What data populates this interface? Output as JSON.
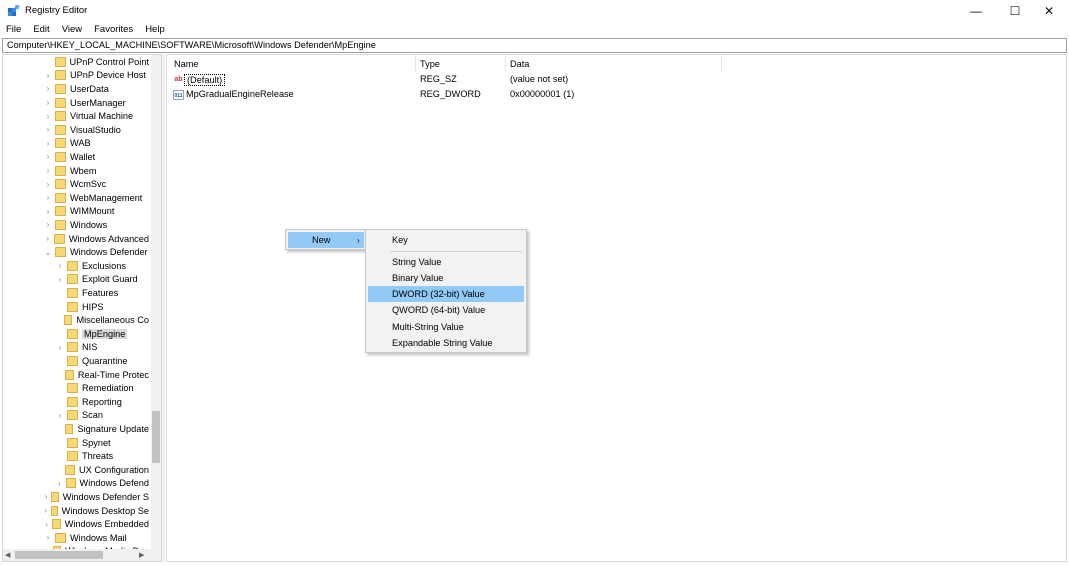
{
  "window": {
    "title": "Registry Editor",
    "min_glyph": "—",
    "max_glyph": "☐",
    "close_glyph": "✕"
  },
  "menu": [
    "File",
    "Edit",
    "View",
    "Favorites",
    "Help"
  ],
  "address": "Computer\\HKEY_LOCAL_MACHINE\\SOFTWARE\\Microsoft\\Windows Defender\\MpEngine",
  "tree": {
    "items": [
      {
        "label": "UPnP Control Point",
        "expander": "",
        "level": 0
      },
      {
        "label": "UPnP Device Host",
        "expander": ">",
        "level": 0
      },
      {
        "label": "UserData",
        "expander": ">",
        "level": 0
      },
      {
        "label": "UserManager",
        "expander": ">",
        "level": 0
      },
      {
        "label": "Virtual Machine",
        "expander": ">",
        "level": 0
      },
      {
        "label": "VisualStudio",
        "expander": ">",
        "level": 0
      },
      {
        "label": "WAB",
        "expander": ">",
        "level": 0
      },
      {
        "label": "Wallet",
        "expander": ">",
        "level": 0
      },
      {
        "label": "Wbem",
        "expander": ">",
        "level": 0
      },
      {
        "label": "WcmSvc",
        "expander": ">",
        "level": 0
      },
      {
        "label": "WebManagement",
        "expander": ">",
        "level": 0
      },
      {
        "label": "WIMMount",
        "expander": ">",
        "level": 0
      },
      {
        "label": "Windows",
        "expander": ">",
        "level": 0
      },
      {
        "label": "Windows Advanced",
        "expander": ">",
        "level": 0
      },
      {
        "label": "Windows Defender",
        "expander": "v",
        "level": 0
      },
      {
        "label": "Exclusions",
        "expander": ">",
        "level": 1
      },
      {
        "label": "Exploit Guard",
        "expander": ">",
        "level": 1
      },
      {
        "label": "Features",
        "expander": "",
        "level": 1
      },
      {
        "label": "HIPS",
        "expander": "",
        "level": 1
      },
      {
        "label": "Miscellaneous Co",
        "expander": "",
        "level": 1
      },
      {
        "label": "MpEngine",
        "expander": "",
        "level": 1,
        "selected": true
      },
      {
        "label": "NIS",
        "expander": ">",
        "level": 1
      },
      {
        "label": "Quarantine",
        "expander": "",
        "level": 1
      },
      {
        "label": "Real-Time Protec",
        "expander": "",
        "level": 1
      },
      {
        "label": "Remediation",
        "expander": "",
        "level": 1
      },
      {
        "label": "Reporting",
        "expander": "",
        "level": 1
      },
      {
        "label": "Scan",
        "expander": ">",
        "level": 1
      },
      {
        "label": "Signature Update",
        "expander": "",
        "level": 1
      },
      {
        "label": "Spynet",
        "expander": "",
        "level": 1
      },
      {
        "label": "Threats",
        "expander": "",
        "level": 1
      },
      {
        "label": "UX Configuration",
        "expander": "",
        "level": 1
      },
      {
        "label": "Windows Defend",
        "expander": ">",
        "level": 1
      },
      {
        "label": "Windows Defender S",
        "expander": ">",
        "level": 0
      },
      {
        "label": "Windows Desktop Se",
        "expander": ">",
        "level": 0
      },
      {
        "label": "Windows Embedded",
        "expander": ">",
        "level": 0
      },
      {
        "label": "Windows Mail",
        "expander": ">",
        "level": 0
      },
      {
        "label": "Windows Media Dev",
        "expander": ">",
        "level": 0
      }
    ]
  },
  "list": {
    "columns": [
      "Name",
      "Type",
      "Data"
    ],
    "rows": [
      {
        "name": "(Default)",
        "type": "REG_SZ",
        "data": "(value not set)",
        "icon": "string-value-icon",
        "icon_glyph": "ab"
      },
      {
        "name": "MpGradualEngineRelease",
        "type": "REG_DWORD",
        "data": "0x00000001 (1)",
        "icon": "dword-value-icon",
        "icon_glyph": "011"
      }
    ]
  },
  "context_menu": {
    "new_label": "New",
    "submenu": {
      "key": "Key",
      "items": [
        "String Value",
        "Binary Value",
        "DWORD (32-bit) Value",
        "QWORD (64-bit) Value",
        "Multi-String Value",
        "Expandable String Value"
      ],
      "highlighted": "DWORD (32-bit) Value"
    }
  },
  "colors": {
    "highlight": "#91c9f7",
    "folder": "#f8d775"
  }
}
